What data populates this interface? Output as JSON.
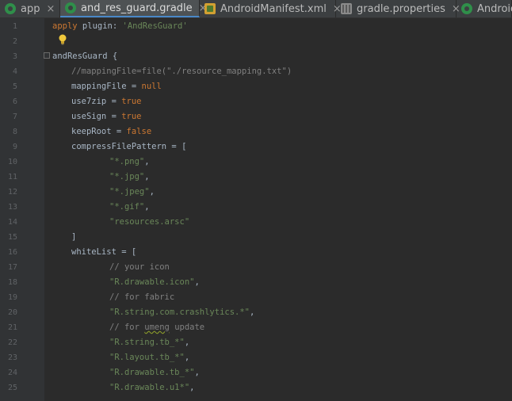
{
  "tabs": [
    {
      "label": "app",
      "icon": "gradle-icon",
      "active": false
    },
    {
      "label": "and_res_guard.gradle",
      "icon": "gradle-icon",
      "active": true
    },
    {
      "label": "AndroidManifest.xml",
      "icon": "xml-icon",
      "active": false
    },
    {
      "label": "gradle.properties",
      "icon": "properties-icon",
      "active": false
    },
    {
      "label": "Android",
      "icon": "gradle-icon",
      "active": false
    }
  ],
  "close_glyph": "×",
  "line_numbers": [
    "1",
    "2",
    "3",
    "4",
    "5",
    "6",
    "7",
    "8",
    "9",
    "10",
    "11",
    "12",
    "13",
    "14",
    "15",
    "16",
    "17",
    "18",
    "19",
    "20",
    "21",
    "22",
    "23",
    "24",
    "25"
  ],
  "code": {
    "l1_a": "apply",
    "l1_b": " plugin: ",
    "l1_c": "'AndResGuard'",
    "l3": "andResGuard {",
    "l4": "//mappingFile=file(\"./resource_mapping.txt\")",
    "l5_a": "mappingFile = ",
    "l5_b": "null",
    "l6_a": "use7zip = ",
    "l6_b": "true",
    "l7_a": "useSign = ",
    "l7_b": "true",
    "l8_a": "keepRoot = ",
    "l8_b": "false",
    "l9": "compressFilePattern = [",
    "l10_a": "\"*.png\"",
    "l10_b": ",",
    "l11_a": "\"*.jpg\"",
    "l11_b": ",",
    "l12_a": "\"*.jpeg\"",
    "l12_b": ",",
    "l13_a": "\"*.gif\"",
    "l13_b": ",",
    "l14": "\"resources.arsc\"",
    "l15": "]",
    "l16": "whiteList = [",
    "l17": "// your icon",
    "l18_a": "\"R.drawable.icon\"",
    "l18_b": ",",
    "l19": "// for fabric",
    "l20_a": "\"R.string.com.crashlytics.*\"",
    "l20_b": ",",
    "l21_a": "// for ",
    "l21_b": "umeng",
    "l21_c": " update",
    "l22_a": "\"R.string.tb_*\"",
    "l22_b": ",",
    "l23_a": "\"R.layout.tb_*\"",
    "l23_b": ",",
    "l24_a": "\"R.drawable.tb_*\"",
    "l24_b": ",",
    "l25_a": "\"R.drawable.u1*\"",
    "l25_b": ","
  },
  "colors": {
    "keyword": "#cc7832",
    "string": "#6a8759",
    "comment": "#808080",
    "text": "#a9b7c6",
    "background": "#2b2b2b",
    "gutter": "#313335"
  }
}
